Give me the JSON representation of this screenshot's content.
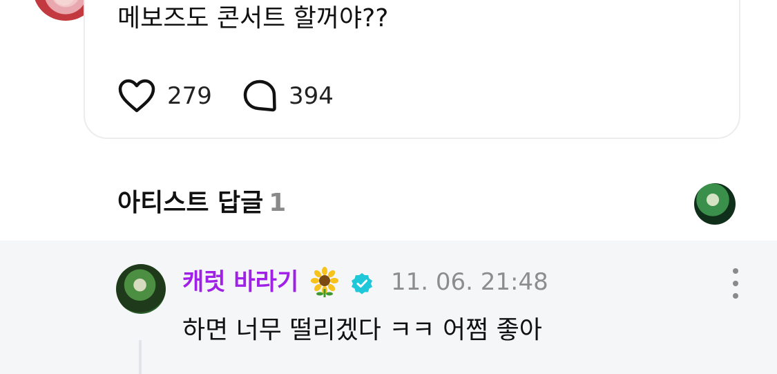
{
  "post": {
    "text": "메보즈도 콘서트 할꺼야??",
    "likes_count": "279",
    "comments_count": "394",
    "icons": {
      "like": "heart-icon",
      "comment": "comment-bubble-icon"
    }
  },
  "section": {
    "title": "아티스트 답글",
    "count": "1"
  },
  "reply": {
    "author_name": "캐럿 바라기",
    "author_emoji": "sunflower-emoji",
    "verified_badge": "verified-badge-icon",
    "timestamp": "11. 06. 21:48",
    "text": "하면 너무 떨리겠다 ㅋㅋ 어쩜 좋아",
    "more_icon": "more-vertical-icon"
  },
  "colors": {
    "author_name": "#a020e8",
    "verified_badge": "#1ec8d8",
    "reply_background": "#f5f6f8",
    "muted_text": "#8d8d8d"
  }
}
